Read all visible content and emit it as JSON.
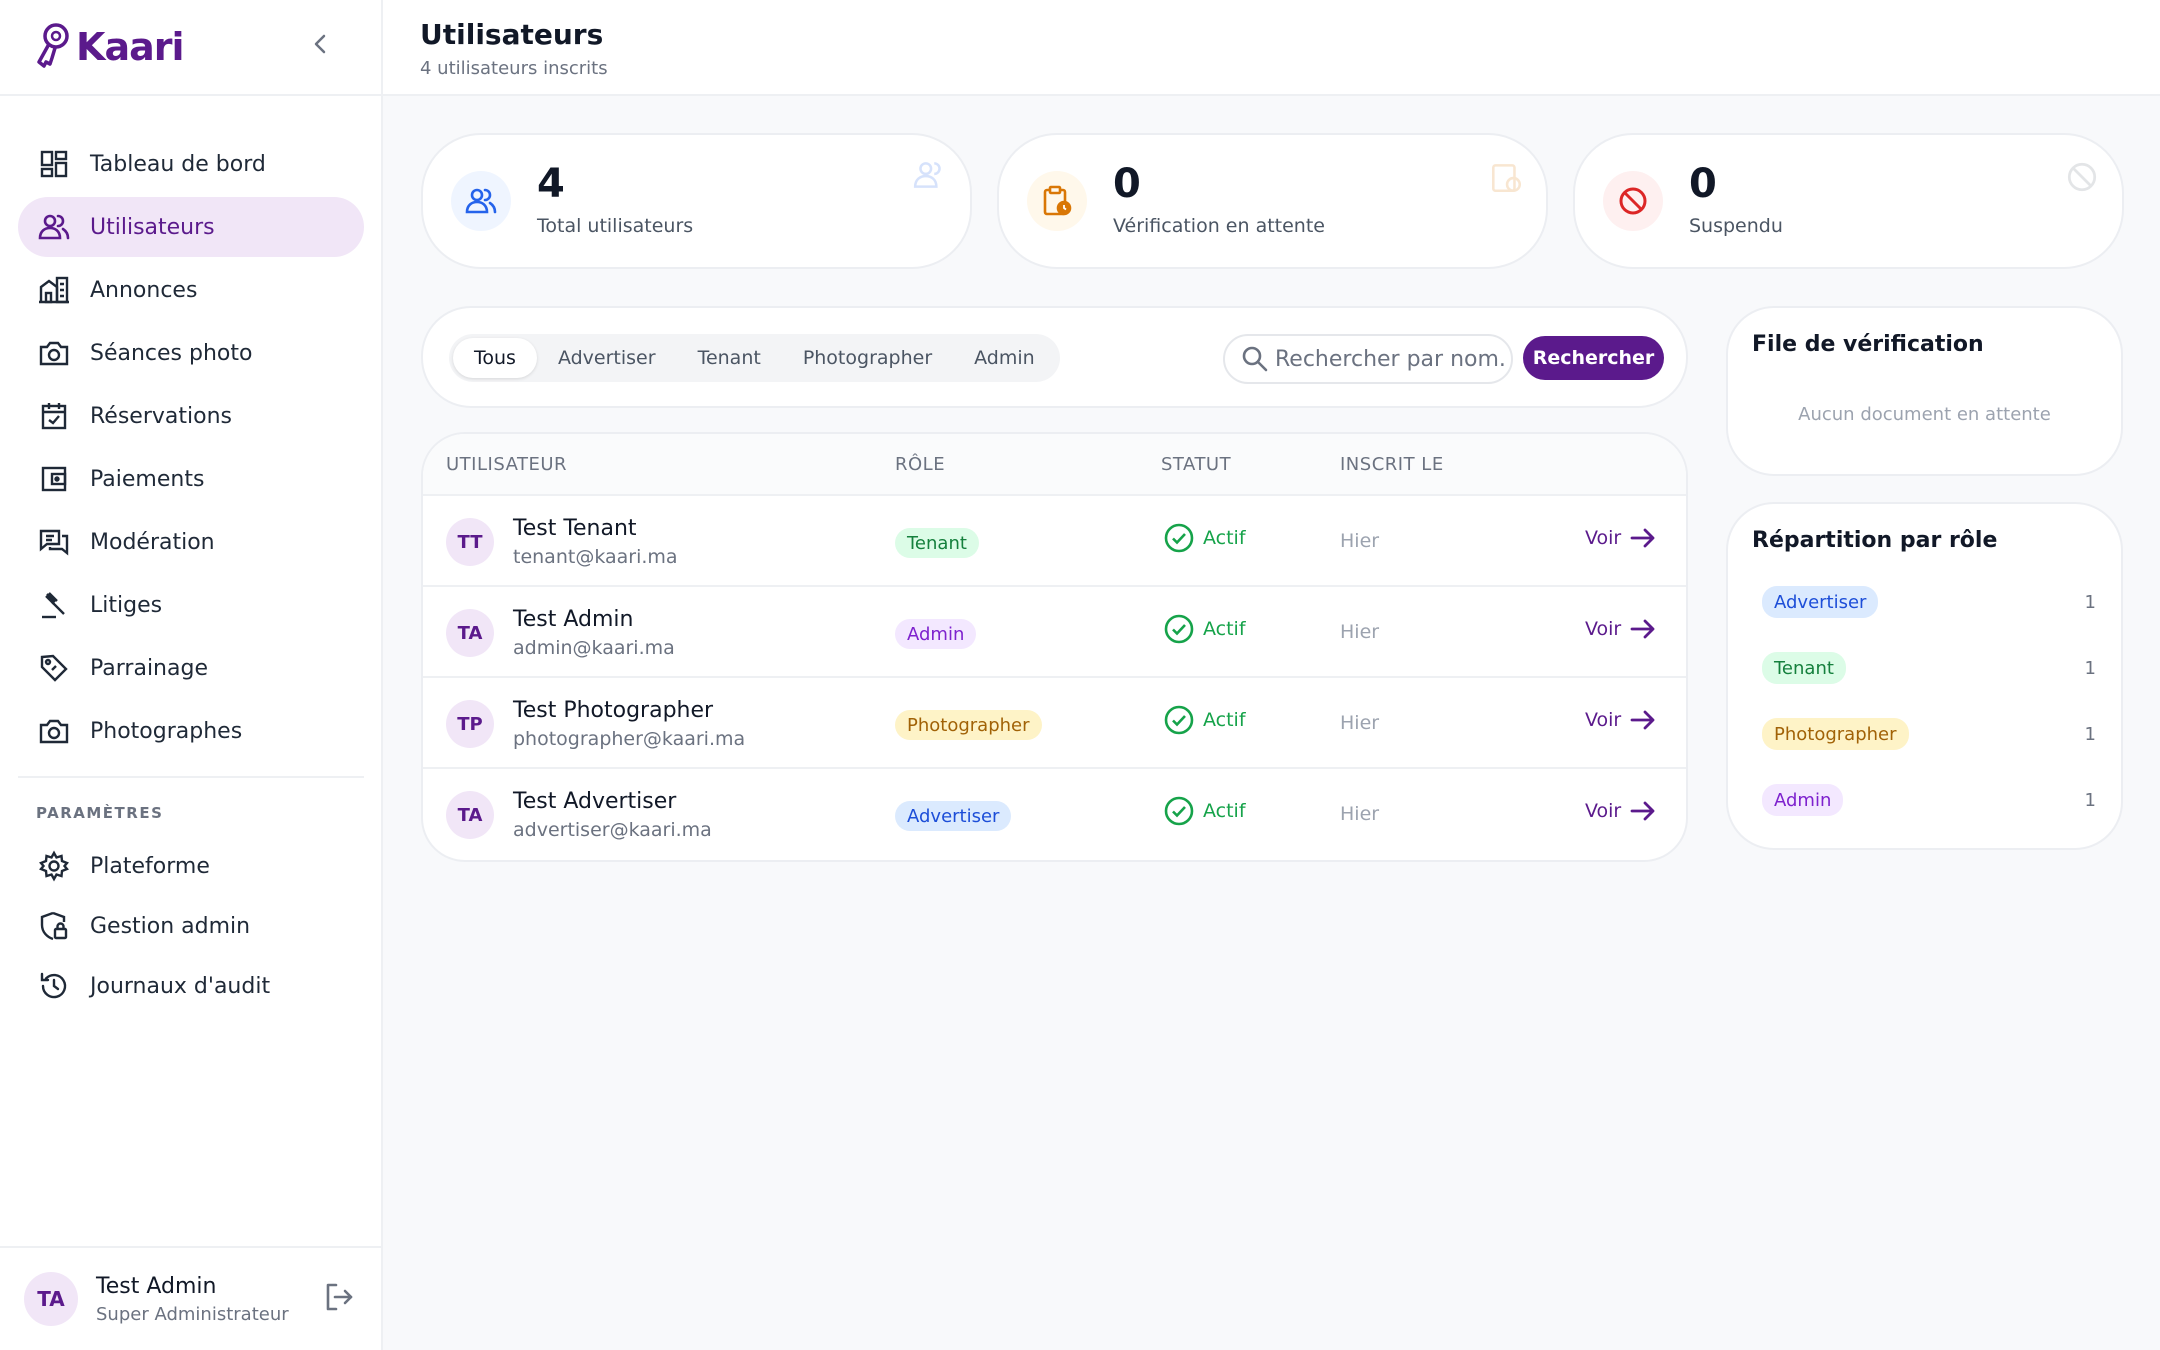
{
  "app": {
    "name": "Kaari"
  },
  "sidebar": {
    "items": [
      {
        "label": "Tableau de bord",
        "icon": "dashboard-icon"
      },
      {
        "label": "Utilisateurs",
        "icon": "users-icon",
        "active": true
      },
      {
        "label": "Annonces",
        "icon": "buildings-icon"
      },
      {
        "label": "Séances photo",
        "icon": "camera-icon"
      },
      {
        "label": "Réservations",
        "icon": "calendar-check-icon"
      },
      {
        "label": "Paiements",
        "icon": "wallet-icon"
      },
      {
        "label": "Modération",
        "icon": "chat-icon"
      },
      {
        "label": "Litiges",
        "icon": "gavel-icon"
      },
      {
        "label": "Parrainage",
        "icon": "tag-icon"
      },
      {
        "label": "Photographes",
        "icon": "camera-icon"
      }
    ],
    "section_label": "PARAMÈTRES",
    "settings_items": [
      {
        "label": "Plateforme",
        "icon": "gear-icon"
      },
      {
        "label": "Gestion admin",
        "icon": "shield-lock-icon"
      },
      {
        "label": "Journaux d'audit",
        "icon": "history-icon"
      }
    ],
    "user": {
      "initials": "TA",
      "name": "Test Admin",
      "role": "Super Administrateur"
    }
  },
  "header": {
    "title": "Utilisateurs",
    "subtitle": "4 utilisateurs inscrits"
  },
  "stats": [
    {
      "value": "4",
      "label": "Total utilisateurs",
      "icon": "users-icon",
      "color": "#2563eb"
    },
    {
      "value": "0",
      "label": "Vérification en attente",
      "icon": "clipboard-clock-icon",
      "color": "#d97706"
    },
    {
      "value": "0",
      "label": "Suspendu",
      "icon": "ban-icon",
      "color": "#dc2626"
    }
  ],
  "filters": {
    "tabs": [
      "Tous",
      "Advertiser",
      "Tenant",
      "Photographer",
      "Admin"
    ],
    "active_tab": "Tous",
    "search_placeholder": "Rechercher par nom...",
    "search_button": "Rechercher"
  },
  "table": {
    "columns": [
      "UTILISATEUR",
      "RÔLE",
      "STATUT",
      "INSCRIT LE"
    ],
    "rows": [
      {
        "initials": "TT",
        "name": "Test Tenant",
        "email": "tenant@kaari.ma",
        "role": "Tenant",
        "status": "Actif",
        "date": "Hier",
        "action": "Voir"
      },
      {
        "initials": "TA",
        "name": "Test Admin",
        "email": "admin@kaari.ma",
        "role": "Admin",
        "status": "Actif",
        "date": "Hier",
        "action": "Voir"
      },
      {
        "initials": "TP",
        "name": "Test Photographer",
        "email": "photographer@kaari.ma",
        "role": "Photographer",
        "status": "Actif",
        "date": "Hier",
        "action": "Voir"
      },
      {
        "initials": "TA",
        "name": "Test Advertiser",
        "email": "advertiser@kaari.ma",
        "role": "Advertiser",
        "status": "Actif",
        "date": "Hier",
        "action": "Voir"
      }
    ]
  },
  "verification_panel": {
    "title": "File de vérification",
    "empty": "Aucun document en attente"
  },
  "role_distribution": {
    "title": "Répartition par rôle",
    "items": [
      {
        "role": "Advertiser",
        "count": "1"
      },
      {
        "role": "Tenant",
        "count": "1"
      },
      {
        "role": "Photographer",
        "count": "1"
      },
      {
        "role": "Admin",
        "count": "1"
      }
    ]
  },
  "colors": {
    "brand": "#5b1a8c",
    "active_bg": "#f1e6f7",
    "success": "#16a34a"
  }
}
